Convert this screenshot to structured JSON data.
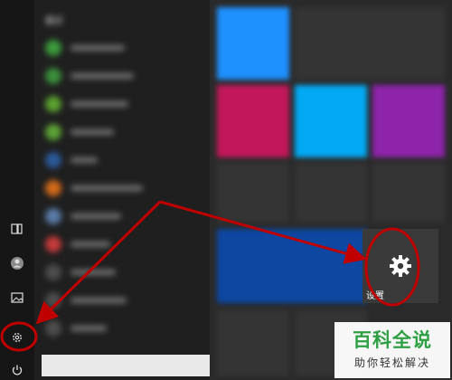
{
  "left_rail": {
    "items": [
      {
        "name": "documents-icon"
      },
      {
        "name": "user-icon"
      },
      {
        "name": "pictures-icon"
      },
      {
        "name": "gear-icon"
      },
      {
        "name": "power-icon"
      }
    ]
  },
  "app_list": {
    "section_heading": "最近",
    "app_icon_colors": [
      "#3c9a3c",
      "#3b8f3b",
      "#5aa02f",
      "#5ca336",
      "#2c5a9a",
      "#d26a1a",
      "#5a7ca8",
      "#c43a3a",
      "#4d4d4d",
      "#4d4d4d",
      "#4d4d4d"
    ]
  },
  "tiles": {
    "colors": {
      "blue": "#1e90ff",
      "magenta": "#c2185b",
      "cyan": "#03a9f4",
      "purple": "#8e24aa",
      "dark_blue": "#0d47a1",
      "gray": "#3a3a3a"
    },
    "settings_tile": {
      "label": "设置",
      "icon": "gear-icon"
    }
  },
  "annotation": {
    "color": "#c00000"
  },
  "watermark": {
    "title": "百科全说",
    "subtitle": "助你轻松解决"
  }
}
